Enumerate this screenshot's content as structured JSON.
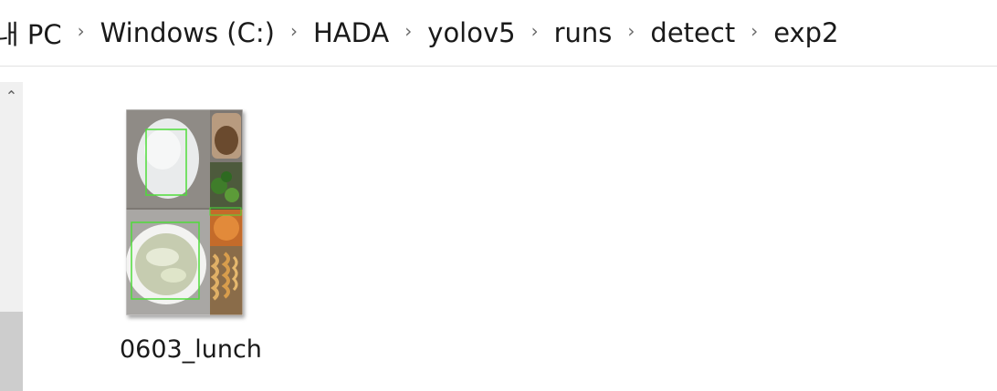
{
  "breadcrumb": {
    "items": [
      "내 PC",
      "Windows (C:)",
      "HADA",
      "yolov5",
      "runs",
      "detect",
      "exp2"
    ],
    "separator": "›"
  },
  "scrollbar": {
    "up_arrow": "⌃"
  },
  "files": [
    {
      "name": "0603_lunch",
      "icon": "image-thumbnail-icon"
    }
  ],
  "colors": {
    "detection_box": "#4fdc3a",
    "background": "#ffffff",
    "scrollbar_track": "#f0f0f0"
  }
}
